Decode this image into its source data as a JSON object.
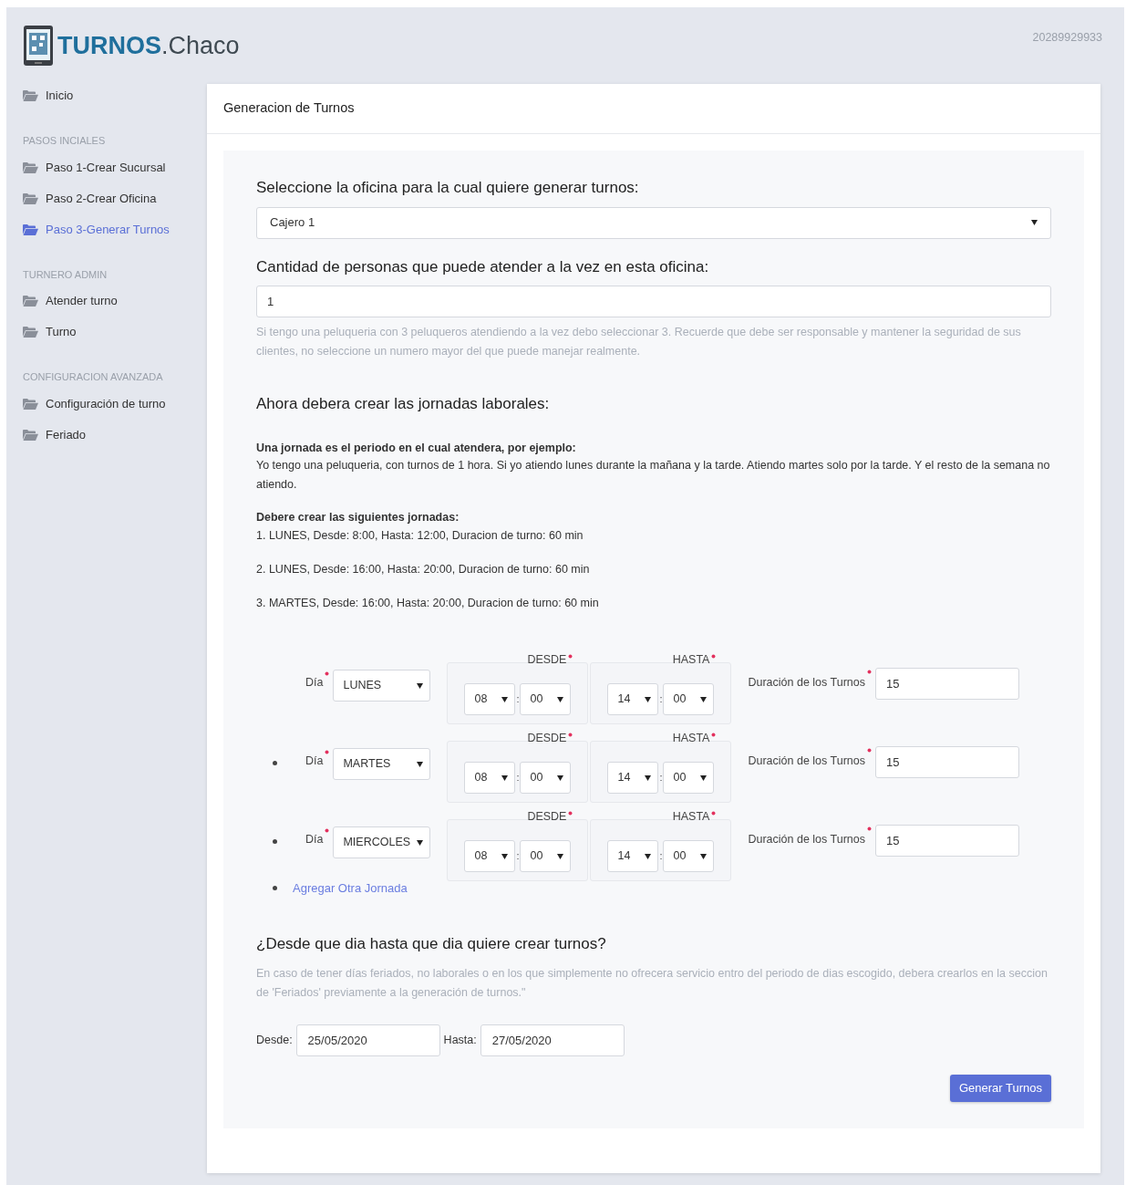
{
  "brand": {
    "strong": "TURNOS",
    "light": ".Chaco"
  },
  "user_id": "20289929933",
  "sidebar": {
    "items": [
      {
        "label": "Inicio",
        "selected": false
      }
    ],
    "sections": [
      {
        "title": "PASOS INCIALES",
        "items": [
          {
            "label": "Paso 1-Crear Sucursal",
            "selected": false
          },
          {
            "label": "Paso 2-Crear Oficina",
            "selected": false
          },
          {
            "label": "Paso 3-Generar Turnos",
            "selected": true
          }
        ]
      },
      {
        "title": "TURNERO ADMIN",
        "items": [
          {
            "label": "Atender turno",
            "selected": false
          },
          {
            "label": "Turno",
            "selected": false
          }
        ]
      },
      {
        "title": "CONFIGURACION AVANZADA",
        "items": [
          {
            "label": "Configuración de turno",
            "selected": false
          },
          {
            "label": "Feriado",
            "selected": false
          }
        ]
      }
    ]
  },
  "card": {
    "title": "Generacion de Turnos",
    "office": {
      "label": "Seleccione la oficina para la cual quiere generar turnos:",
      "value": "Cajero 1"
    },
    "capacity": {
      "label": "Cantidad de personas que puede atender a la vez en esta oficina:",
      "value": "1",
      "help": "Si tengo una peluqueria con 3 peluqueros atendiendo a la vez debo seleccionar 3. Recuerde que debe ser responsable y mantener la seguridad de sus clientes, no seleccione un numero mayor del que puede manejar realmente."
    },
    "jornadas_heading": "Ahora debera crear las jornadas laborales:",
    "example": {
      "title": "Una jornada es el periodo en el cual atendera, por ejemplo:",
      "text": "Yo tengo una peluqueria, con turnos de 1 hora. Si yo atiendo lunes durante la mañana y la tarde. Atiendo martes solo por la tarde. Y el resto de la semana no atiendo.",
      "list_title": "Debere crear las siguientes jornadas:",
      "lines": [
        "1. LUNES, Desde: 8:00, Hasta: 12:00, Duracion de turno: 60 min",
        "2. LUNES, Desde: 16:00, Hasta: 20:00, Duracion de turno: 60 min",
        "3. MARTES, Desde: 16:00, Hasta: 20:00, Duracion de turno: 60 min"
      ]
    },
    "jornadas": [
      {
        "bullet": false,
        "day_label": "Día",
        "day": "LUNES",
        "desde_label": "DESDE",
        "desde_hour": "08",
        "desde_min": "00",
        "hasta_label": "HASTA",
        "hasta_hour": "14",
        "hasta_min": "00",
        "separator": ":",
        "duration_label": "Duración de los Turnos",
        "duration": "15"
      },
      {
        "bullet": true,
        "day_label": "Día",
        "day": "MARTES",
        "desde_label": "DESDE",
        "desde_hour": "08",
        "desde_min": "00",
        "hasta_label": "HASTA",
        "hasta_hour": "14",
        "hasta_min": "00",
        "separator": ":",
        "duration_label": "Duración de los Turnos",
        "duration": "15"
      },
      {
        "bullet": true,
        "day_label": "Día",
        "day": "MIERCOLES",
        "desde_label": "DESDE",
        "desde_hour": "08",
        "desde_min": "00",
        "hasta_label": "HASTA",
        "hasta_hour": "14",
        "hasta_min": "00",
        "separator": ":",
        "duration_label": "Duración de los Turnos",
        "duration": "15"
      }
    ],
    "add_link": "Agregar Otra Jornada",
    "range_heading": "¿Desde que dia hasta que dia quiere crear turnos?",
    "range_help": "En caso de tener días feriados, no laborales o en los que simplemente no ofrecera servicio entro del periodo de dias escogido, debera crearlos en la seccion de 'Feriados' previamente a la generación de turnos.\"",
    "from_label": "Desde:",
    "from": "25/05/2020",
    "to_label": "Hasta:",
    "to": "27/05/2020",
    "submit": "Generar Turnos"
  }
}
